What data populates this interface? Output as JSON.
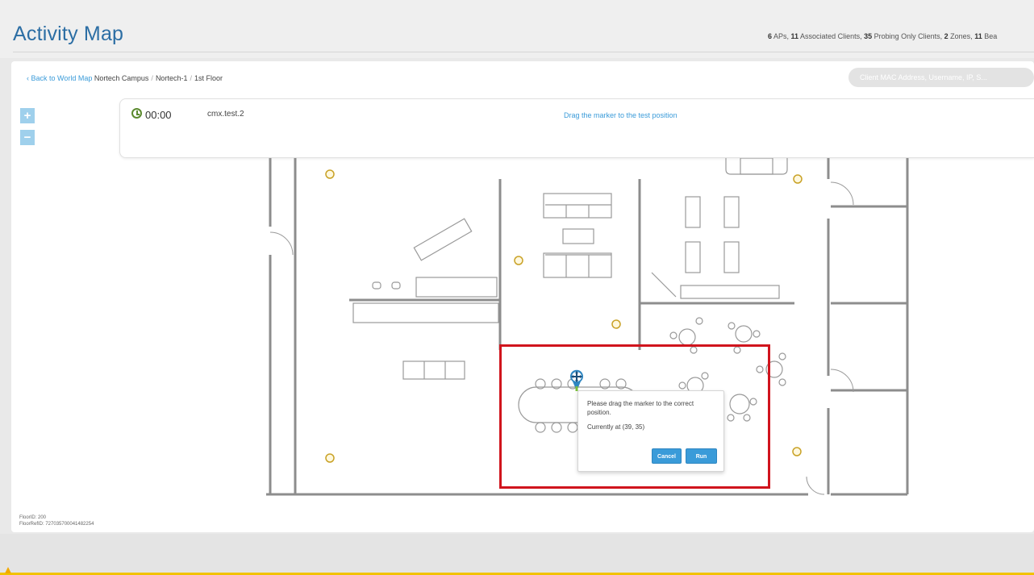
{
  "header": {
    "title": "Activity Map",
    "stats": [
      {
        "value": "6",
        "label": " APs, "
      },
      {
        "value": "11",
        "label": " Associated Clients, "
      },
      {
        "value": "35",
        "label": " Probing Only Clients, "
      },
      {
        "value": "2",
        "label": " Zones, "
      },
      {
        "value": "11",
        "label": " Bea"
      }
    ]
  },
  "breadcrumb": {
    "back": "Back to World Map",
    "campus": "Nortech Campus",
    "separator": "/",
    "building": "Nortech-1",
    "floor": "1st Floor"
  },
  "search": {
    "placeholder": "Client MAC Address, Username, IP, S..."
  },
  "zoom": {
    "in": "+",
    "out": "−"
  },
  "test": {
    "timer": "00:00",
    "name": "cmx.test.2",
    "instruction": "Drag the marker to the test position"
  },
  "popup": {
    "message": "Please drag the marker to the correct position.",
    "position": "Currently at (39, 35)",
    "cancel": "Cancel",
    "run": "Run"
  },
  "floor_meta": {
    "floor_id": "FloorID: 200",
    "floor_ref_id": "FloorRefID: 727035700041482254"
  },
  "colors": {
    "accent": "#3a9bd9",
    "selection": "#d0141d",
    "title": "#2c6ea4",
    "ap_marker": "#c9a227"
  },
  "icons": {
    "timer": "clock-icon",
    "marker": "move-marker-icon",
    "warning": "warning-icon"
  }
}
